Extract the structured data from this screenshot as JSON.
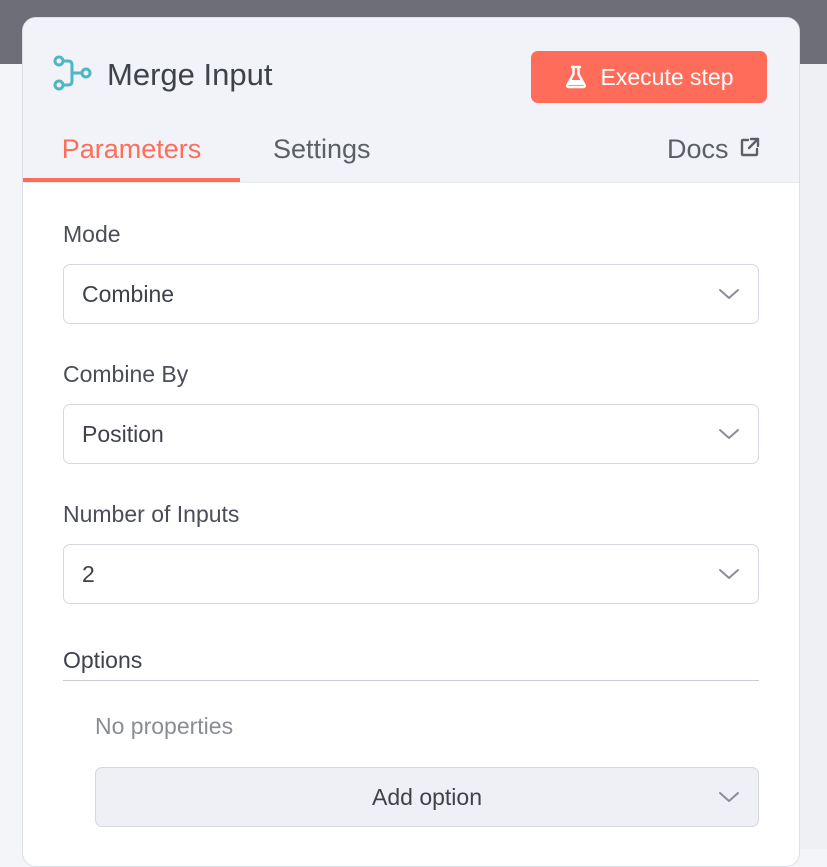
{
  "node": {
    "title": "Merge Input",
    "icon": "merge-node-icon",
    "execute_label": "Execute step",
    "accent_color": "#ff6d5a",
    "icon_color": "#4fb7c4"
  },
  "tabs": [
    {
      "label": "Parameters",
      "active": true
    },
    {
      "label": "Settings",
      "active": false
    },
    {
      "label": "Docs",
      "icon": "external-link-icon",
      "active": false
    }
  ],
  "fields": {
    "mode": {
      "label": "Mode",
      "value": "Combine"
    },
    "combine_by": {
      "label": "Combine By",
      "value": "Position"
    },
    "number_of_inputs": {
      "label": "Number of Inputs",
      "value": "2"
    }
  },
  "options": {
    "title": "Options",
    "empty_text": "No properties",
    "add_label": "Add option"
  }
}
